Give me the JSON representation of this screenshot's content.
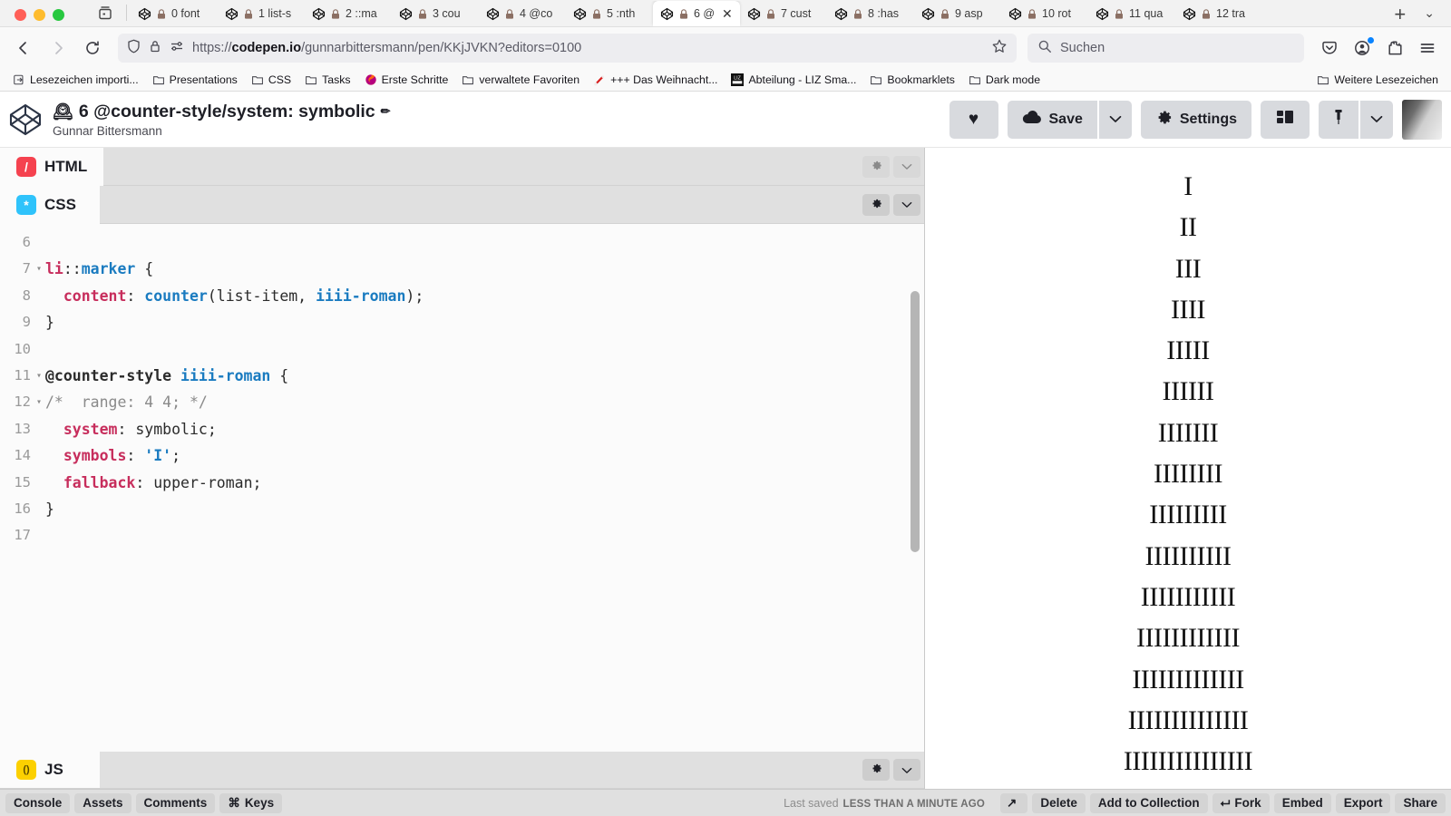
{
  "browser": {
    "window_controls": [
      "close",
      "minimize",
      "maximize"
    ],
    "tab_list_icon": "tab-list-icon",
    "new_tab_label": "+",
    "tab_overflow_label": "⌄",
    "tabs": [
      {
        "label": "0 font",
        "active": false
      },
      {
        "label": "1 list-s",
        "active": false
      },
      {
        "label": "2 ::ma",
        "active": false
      },
      {
        "label": "3 cou",
        "active": false
      },
      {
        "label": "4 @co",
        "active": false
      },
      {
        "label": "5 :nth",
        "active": false
      },
      {
        "label": "6 @",
        "active": true
      },
      {
        "label": "7 cust",
        "active": false
      },
      {
        "label": "8 :has",
        "active": false
      },
      {
        "label": "9 asp",
        "active": false
      },
      {
        "label": "10 rot",
        "active": false
      },
      {
        "label": "11 qua",
        "active": false
      },
      {
        "label": "12 tra",
        "active": false
      }
    ],
    "nav": {
      "back_icon": "back-arrow-icon",
      "forward_icon": "forward-arrow-icon",
      "reload_icon": "reload-icon",
      "shield_icon": "shield-icon",
      "lock_icon": "lock-icon",
      "permissions_icon": "permissions-icon",
      "bookmark_star_icon": "star-icon",
      "url_prefix": "https://",
      "url_domain": "codepen.io",
      "url_path": "/gunnarbittersmann/pen/KKjJVKN?editors=0100",
      "search_placeholder": "Suchen",
      "pocket_icon": "pocket-icon",
      "account_icon": "account-icon",
      "extensions_icon": "extensions-icon",
      "menu_icon": "hamburger-menu-icon"
    },
    "bookmarks": [
      {
        "label": "Lesezeichen importi...",
        "icon": "import-icon"
      },
      {
        "label": "Presentations",
        "icon": "folder-icon"
      },
      {
        "label": "CSS",
        "icon": "folder-icon"
      },
      {
        "label": "Tasks",
        "icon": "folder-icon"
      },
      {
        "label": "Erste Schritte",
        "icon": "firefox-icon"
      },
      {
        "label": "verwaltete Favoriten",
        "icon": "folder-icon"
      },
      {
        "label": "+++ Das Weihnacht...",
        "icon": "santa-icon"
      },
      {
        "label": "Abteilung - LIZ Sma...",
        "icon": "liz-icon"
      },
      {
        "label": "Bookmarklets",
        "icon": "folder-icon"
      },
      {
        "label": "Dark mode",
        "icon": "folder-icon"
      }
    ],
    "bookmarks_overflow": {
      "label": "Weitere Lesezeichen",
      "icon": "folder-icon"
    }
  },
  "codepen": {
    "logo_icon": "codepen-logo-icon",
    "title_emoji": "🕰",
    "title": "6 @counter-style/system: symbolic",
    "edit_icon": "pencil-icon",
    "author": "Gunnar Bittersmann",
    "actions": {
      "love_label": "♥",
      "save_label": "Save",
      "save_icon": "cloud-icon",
      "save_caret": "⌄",
      "settings_label": "Settings",
      "settings_icon": "gear-icon",
      "layout_icon": "layout-icon",
      "pin_icon": "pin-icon",
      "pin_caret": "⌄"
    },
    "avatar_alt": "user-avatar"
  },
  "editors": {
    "html_pane": {
      "name": "HTML",
      "badge": "/",
      "badge_color": "#f5424f",
      "settings_icon": "gear-icon",
      "collapse_icon": "chevron-down-icon"
    },
    "css_pane": {
      "name": "CSS",
      "badge": "*",
      "badge_color": "#2fc3fb",
      "settings_icon": "gear-icon",
      "collapse_icon": "chevron-down-icon"
    },
    "js_pane": {
      "name": "JS",
      "badge": "()",
      "badge_color": "#fcd000",
      "settings_icon": "gear-icon",
      "collapse_icon": "chevron-down-icon"
    },
    "css_code_lines": [
      {
        "number": "6",
        "fold": "",
        "tokens": []
      },
      {
        "number": "7",
        "fold": "▾",
        "tokens": [
          {
            "t": "li",
            "c": "tok-sel"
          },
          {
            "t": "::",
            "c": "tok-plain"
          },
          {
            "t": "marker",
            "c": "tok-pseudo"
          },
          {
            "t": " {",
            "c": "tok-plain"
          }
        ]
      },
      {
        "number": "8",
        "fold": "",
        "tokens": [
          {
            "t": "  ",
            "c": "tok-plain"
          },
          {
            "t": "content",
            "c": "tok-sel"
          },
          {
            "t": ": ",
            "c": "tok-plain"
          },
          {
            "t": "counter",
            "c": "tok-pseudo"
          },
          {
            "t": "(list-item, ",
            "c": "tok-plain"
          },
          {
            "t": "iiii-roman",
            "c": "tok-ident"
          },
          {
            "t": ");",
            "c": "tok-plain"
          }
        ]
      },
      {
        "number": "9",
        "fold": "",
        "tokens": [
          {
            "t": "}",
            "c": "tok-plain"
          }
        ]
      },
      {
        "number": "10",
        "fold": "",
        "tokens": []
      },
      {
        "number": "11",
        "fold": "▾",
        "tokens": [
          {
            "t": "@counter-style",
            "c": "tok-at"
          },
          {
            "t": " ",
            "c": "tok-plain"
          },
          {
            "t": "iiii-roman",
            "c": "tok-ident"
          },
          {
            "t": " {",
            "c": "tok-plain"
          }
        ]
      },
      {
        "number": "12",
        "fold": "▾",
        "tokens": [
          {
            "t": "/*  range: 4 4; */",
            "c": "tok-comment"
          }
        ]
      },
      {
        "number": "13",
        "fold": "",
        "tokens": [
          {
            "t": "  ",
            "c": "tok-plain"
          },
          {
            "t": "system",
            "c": "tok-sel"
          },
          {
            "t": ": symbolic;",
            "c": "tok-plain"
          }
        ]
      },
      {
        "number": "14",
        "fold": "",
        "tokens": [
          {
            "t": "  ",
            "c": "tok-plain"
          },
          {
            "t": "symbols",
            "c": "tok-sel"
          },
          {
            "t": ": ",
            "c": "tok-plain"
          },
          {
            "t": "'I'",
            "c": "tok-str"
          },
          {
            "t": ";",
            "c": "tok-plain"
          }
        ]
      },
      {
        "number": "15",
        "fold": "",
        "tokens": [
          {
            "t": "  ",
            "c": "tok-plain"
          },
          {
            "t": "fallback",
            "c": "tok-sel"
          },
          {
            "t": ": upper-roman;",
            "c": "tok-plain"
          }
        ]
      },
      {
        "number": "16",
        "fold": "",
        "tokens": [
          {
            "t": "}",
            "c": "tok-plain"
          }
        ]
      },
      {
        "number": "17",
        "fold": "",
        "tokens": []
      }
    ]
  },
  "preview": {
    "markers": [
      "I",
      "II",
      "III",
      "IIII",
      "IIIII",
      "IIIIII",
      "IIIIIII",
      "IIIIIIII",
      "IIIIIIIII",
      "IIIIIIIIII",
      "IIIIIIIIIII",
      "IIIIIIIIIIII",
      "IIIIIIIIIIIII",
      "IIIIIIIIIIIIII",
      "IIIIIIIIIIIIIII"
    ]
  },
  "footer": {
    "left_buttons": [
      {
        "label": "Console",
        "icon": ""
      },
      {
        "label": "Assets",
        "icon": ""
      },
      {
        "label": "Comments",
        "icon": ""
      },
      {
        "label": "Keys",
        "icon": "⌘"
      }
    ],
    "saved_label": "Last saved",
    "saved_when": "LESS THAN A MINUTE AGO",
    "right_buttons": [
      {
        "label": "",
        "icon": "↗",
        "name": "open-external"
      },
      {
        "label": "Delete",
        "icon": "",
        "name": "delete"
      },
      {
        "label": "Add to Collection",
        "icon": "",
        "name": "add-to-collection"
      },
      {
        "label": "Fork",
        "icon": "⮠",
        "name": "fork"
      },
      {
        "label": "Embed",
        "icon": "",
        "name": "embed"
      },
      {
        "label": "Export",
        "icon": "",
        "name": "export"
      },
      {
        "label": "Share",
        "icon": "",
        "name": "share"
      }
    ]
  }
}
